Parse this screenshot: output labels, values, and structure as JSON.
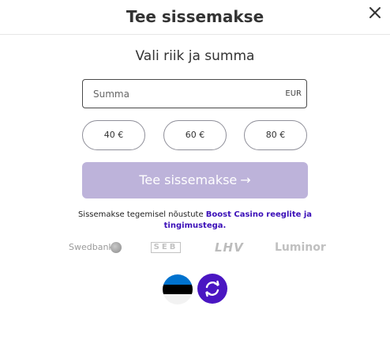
{
  "header": {
    "title": "Tee sissemakse",
    "close_icon": "close-icon"
  },
  "subtitle": "Vali riik ja summa",
  "amount_field": {
    "placeholder": "Summa",
    "currency": "EUR"
  },
  "presets": [
    {
      "label": "40 €"
    },
    {
      "label": "60 €"
    },
    {
      "label": "80 €"
    }
  ],
  "cta": {
    "label": "Tee sissemakse",
    "arrow": "→"
  },
  "terms": {
    "text": "Sissemakse tegemisel nõustute",
    "link": "Boost Casino reeglite ja tingimustega."
  },
  "banks": [
    {
      "label": "Swedbank"
    },
    {
      "label": "SEB"
    },
    {
      "label": "LHV"
    },
    {
      "label": "Luminor"
    }
  ],
  "colors": {
    "accent": "#4a16c2",
    "cta_disabled": "#bdb3da",
    "link": "#3b0fb8",
    "flag_blue": "#0072ce"
  },
  "icons": {
    "country": "estonia-flag-icon",
    "swap": "refresh-icon"
  }
}
